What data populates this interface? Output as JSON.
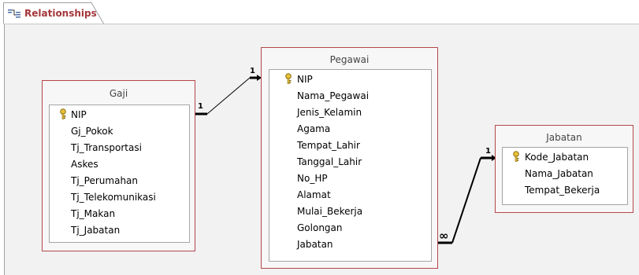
{
  "tab": {
    "label": "Relationships",
    "icon": "relationships-icon"
  },
  "colors": {
    "accent": "#a4373a",
    "border": "#b4474a",
    "canvas": "#f2f2f2"
  },
  "tables": {
    "gaji": {
      "title": "Gaji",
      "fields": [
        "NIP",
        "Gj_Pokok",
        "Tj_Transportasi",
        "Askes",
        "Tj_Perumahan",
        "Tj_Telekomunikasi",
        "Tj_Makan",
        "Tj_Jabatan"
      ]
    },
    "pegawai": {
      "title": "Pegawai",
      "fields": [
        "NIP",
        "Nama_Pegawai",
        "Jenis_Kelamin",
        "Agama",
        "Tempat_Lahir",
        "Tanggal_Lahir",
        "No_HP",
        "Alamat",
        "Mulai_Bekerja",
        "Golongan",
        "Jabatan"
      ]
    },
    "jabatan": {
      "title": "Jabatan",
      "fields": [
        "Kode_Jabatan",
        "Nama_Jabatan",
        "Tempat_Bekerja"
      ]
    }
  },
  "relationships": {
    "gaji_pegawai": {
      "from": "Gaji.NIP",
      "to": "Pegawai.NIP",
      "from_label": "1",
      "to_label": "1"
    },
    "pegawai_jabatan": {
      "from": "Pegawai.Jabatan",
      "to": "Jabatan.Kode_Jabatan",
      "from_label": "∞",
      "to_label": "1"
    }
  }
}
